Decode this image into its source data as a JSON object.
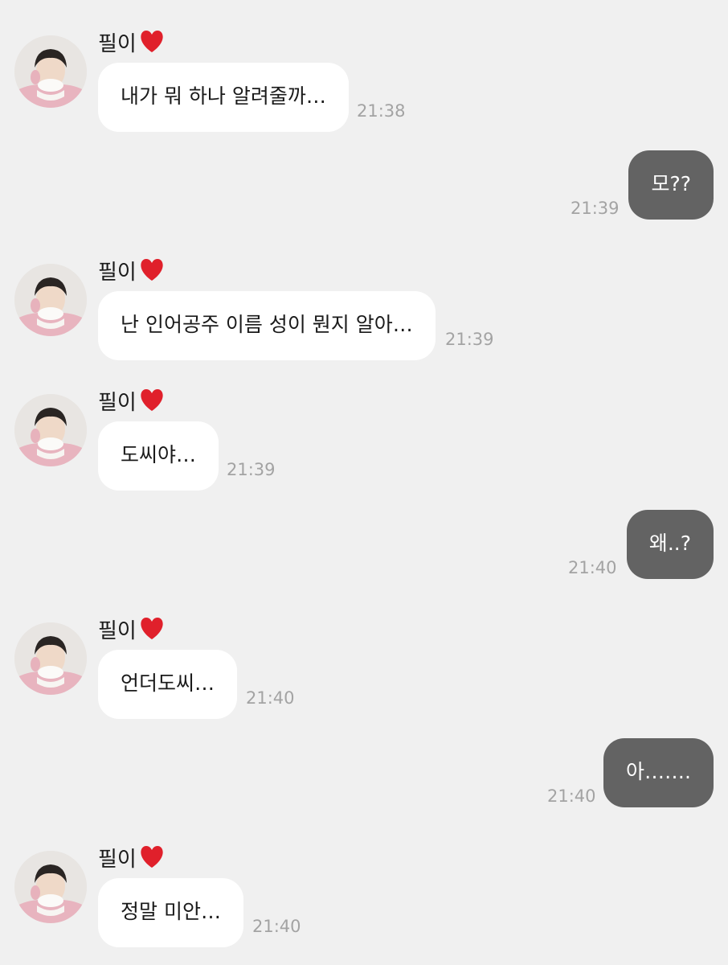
{
  "contact": {
    "name": "필이",
    "heart_icon": "red-heart-icon"
  },
  "colors": {
    "background": "#f0f0f0",
    "incoming_bubble": "#ffffff",
    "outgoing_bubble": "#636363",
    "timestamp": "#a3a3a3"
  },
  "messages": [
    {
      "direction": "incoming",
      "sender": "필이",
      "text": "내가 뭐 하나 알려줄까…",
      "time": "21:38"
    },
    {
      "direction": "outgoing",
      "text": "모??",
      "time": "21:39"
    },
    {
      "direction": "incoming",
      "sender": "필이",
      "text": "난 인어공주 이름 성이 뭔지 알아…",
      "time": "21:39"
    },
    {
      "direction": "incoming",
      "sender": "필이",
      "text": "도씨야…",
      "time": "21:39"
    },
    {
      "direction": "outgoing",
      "text": "왜..?",
      "time": "21:40"
    },
    {
      "direction": "incoming",
      "sender": "필이",
      "text": "언더도씨…",
      "time": "21:40"
    },
    {
      "direction": "outgoing",
      "text": "아…….",
      "time": "21:40"
    },
    {
      "direction": "incoming",
      "sender": "필이",
      "text": "정말 미안…",
      "time": "21:40"
    }
  ]
}
